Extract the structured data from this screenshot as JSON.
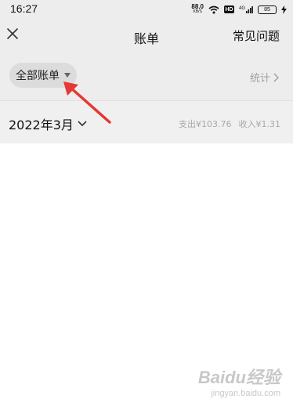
{
  "status_bar": {
    "time": "16:27",
    "net_speed_value": "88.0",
    "net_speed_unit": "KB/S",
    "hd_label": "HD",
    "signal_label": "4G",
    "battery": "85"
  },
  "nav": {
    "title": "账单",
    "faq": "常见问题",
    "close_icon": "close-icon"
  },
  "filter": {
    "chip_label": "全部账单",
    "stats_label": "统计"
  },
  "month": {
    "label": "2022年3月",
    "expense": "支出¥103.76",
    "income": "收入¥1.31"
  },
  "watermark": {
    "brand": "Baidu经验",
    "url": "jingyan.baidu.com"
  },
  "colors": {
    "header_bg": "#ededed",
    "chip_bg": "#dcdcdc",
    "arrow": "#e53935"
  }
}
